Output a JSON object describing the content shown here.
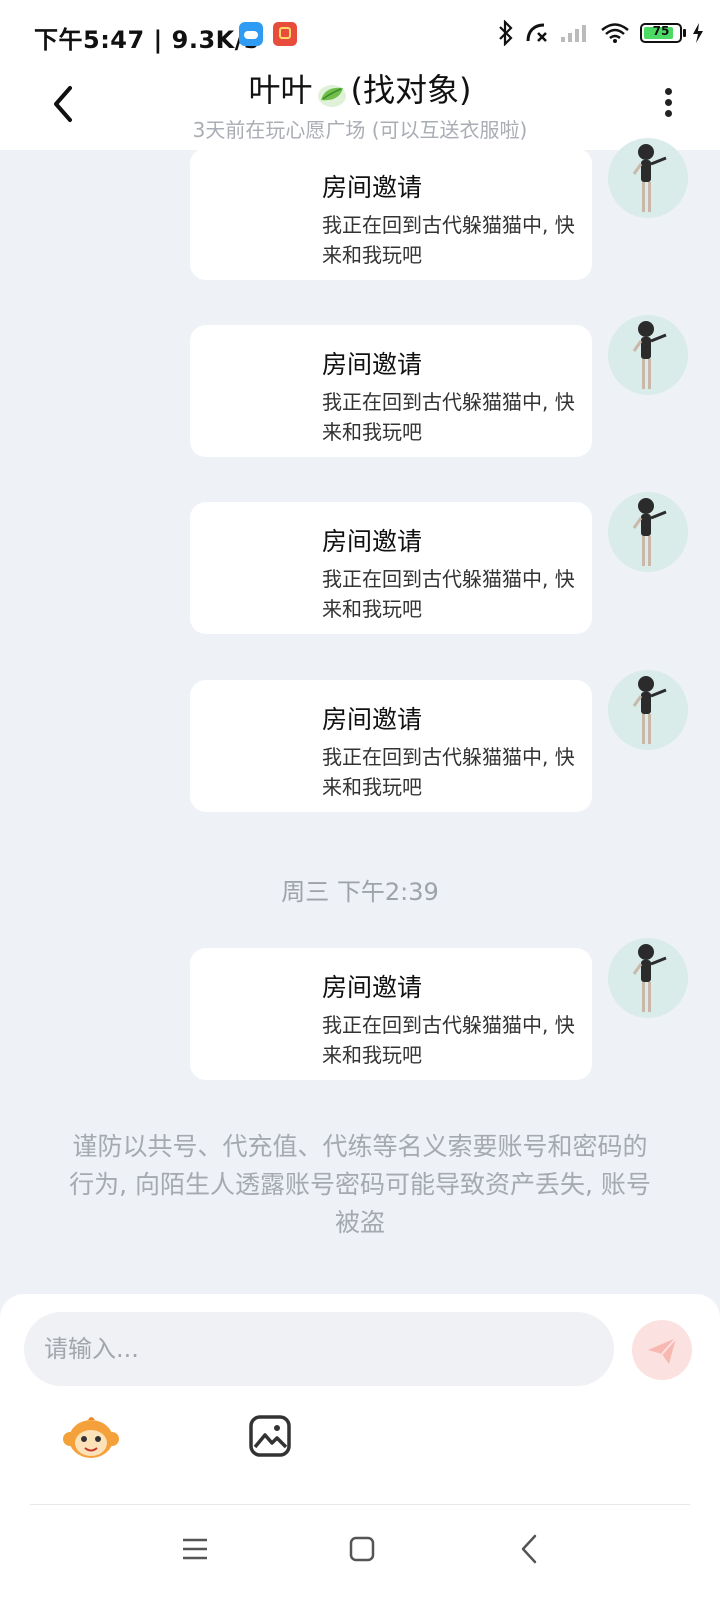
{
  "status_bar": {
    "time_speed": "下午5:47 | 9.3K/s",
    "battery": "75"
  },
  "header": {
    "name": "叶叶",
    "tag": "(找对象)",
    "subtitle": "3天前在玩心愿广场 (可以互送衣服啦)"
  },
  "messages": [
    {
      "title": "房间邀请",
      "text": "我正在回到古代躲猫猫中, 快来和我玩吧"
    },
    {
      "title": "房间邀请",
      "text": "我正在回到古代躲猫猫中, 快来和我玩吧"
    },
    {
      "title": "房间邀请",
      "text": "我正在回到古代躲猫猫中, 快来和我玩吧"
    },
    {
      "title": "房间邀请",
      "text": "我正在回到古代躲猫猫中, 快来和我玩吧"
    },
    {
      "title": "房间邀请",
      "text": "我正在回到古代躲猫猫中, 快来和我玩吧"
    }
  ],
  "timestamp": "周三 下午2:39",
  "warning": "谨防以共号、代充值、代练等名义索要账号和密码的行为, 向陌生人透露账号密码可能导致资产丢失, 账号被盗",
  "composer": {
    "placeholder": "请输入..."
  },
  "icons": {
    "back": "back-arrow-icon",
    "more": "more-vertical-icon",
    "send": "send-icon",
    "emoji": "monkey-emoji-icon",
    "image": "image-icon"
  },
  "colors": {
    "background": "#eef1f6",
    "bubble": "#ffffff",
    "send_button": "#fbe1df",
    "muted_text": "#a5a9b0"
  }
}
